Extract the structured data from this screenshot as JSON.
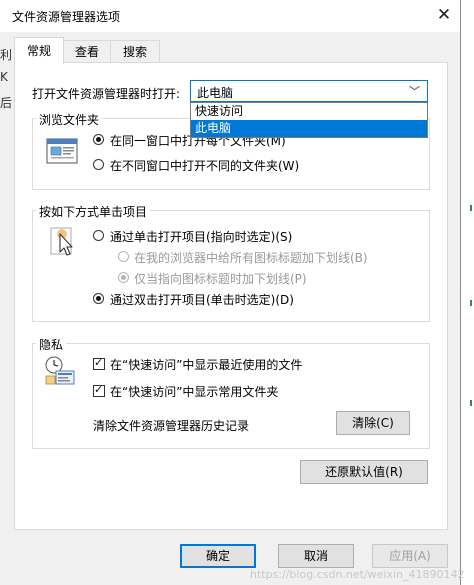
{
  "window": {
    "title": "文件资源管理器选项"
  },
  "tabs": [
    {
      "label": "常规",
      "active": true
    },
    {
      "label": "查看",
      "active": false
    },
    {
      "label": "搜索",
      "active": false
    }
  ],
  "open_with": {
    "label": "打开文件资源管理器时打开:",
    "value": "此电脑",
    "options": [
      {
        "label": "快速访问",
        "selected": false
      },
      {
        "label": "此电脑",
        "selected": true
      }
    ]
  },
  "browse": {
    "title": "浏览文件夹",
    "options": [
      {
        "label": "在同一窗口中打开每个文件夹(M)",
        "checked": true
      },
      {
        "label": "在不同窗口中打开不同的文件夹(W)",
        "checked": false
      }
    ]
  },
  "click": {
    "title": "按如下方式单击项目",
    "single": {
      "label": "通过单击打开项目(指向时选定)(S)",
      "checked": false
    },
    "underline_browser": {
      "label": "在我的浏览器中给所有图标标题加下划线(B)",
      "checked": false
    },
    "underline_hover": {
      "label": "仅当指向图标标题时加下划线(P)",
      "checked": true
    },
    "double": {
      "label": "通过双击打开项目(单击时选定)(D)",
      "checked": true
    }
  },
  "privacy": {
    "title": "隐私",
    "recent_files": {
      "label": "在“快速访问”中显示最近使用的文件",
      "checked": true
    },
    "frequent_folders": {
      "label": "在“快速访问”中显示常用文件夹",
      "checked": true
    },
    "clear_label": "清除文件资源管理器历史记录",
    "clear_button": "清除(C)"
  },
  "restore_button": "还原默认值(R)",
  "footer": {
    "ok": "确定",
    "cancel": "取消",
    "apply": "应用(A)"
  },
  "background": {
    "chars": [
      "利",
      "K",
      "后"
    ]
  },
  "watermark": "https://blog.csdn.net/weixin_41890142"
}
